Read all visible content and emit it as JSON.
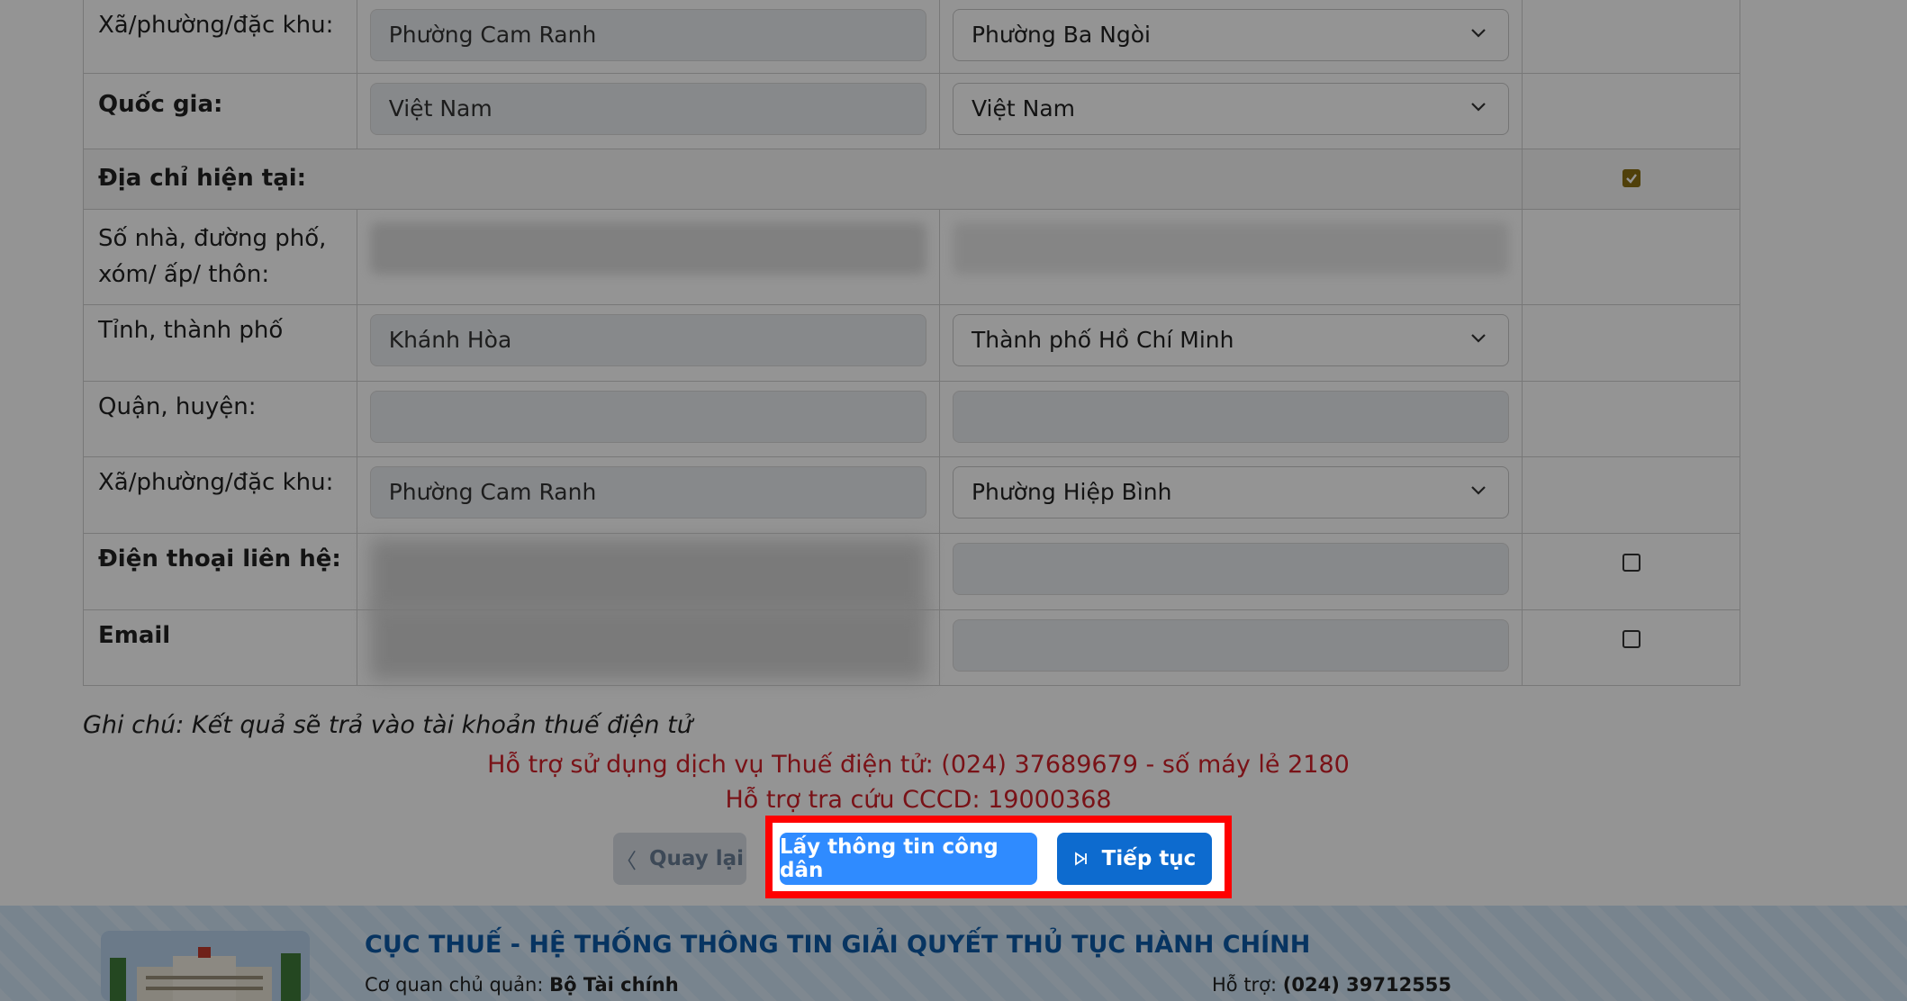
{
  "rows": [
    {
      "label": "Xã/phường/đặc khu:",
      "bold": false,
      "old_value": "Phường Cam Ranh",
      "new_value": "Phường Ba Ngòi",
      "new_type": "select"
    },
    {
      "label": "Quốc gia:",
      "bold": true,
      "old_value": "Việt Nam",
      "new_value": "Việt Nam",
      "new_type": "select"
    },
    {
      "label": "Địa chỉ hiện tại:",
      "bold": true
    },
    {
      "label": "Số nhà, đường phố, xóm/ ấp/ thôn:",
      "bold": false
    },
    {
      "label": "Tỉnh, thành phố",
      "bold": false,
      "old_value": "Khánh Hòa",
      "new_value": "Thành phố Hồ Chí Minh",
      "new_type": "select"
    },
    {
      "label": "Quận, huyện:",
      "bold": false,
      "old_value": "",
      "new_value": ""
    },
    {
      "label": "Xã/phường/đặc khu:",
      "bold": false,
      "old_value": "Phường Cam Ranh",
      "new_value": "Phường Hiệp Bình",
      "new_type": "select"
    },
    {
      "label": "Điện thoại liên hệ:",
      "bold": true
    },
    {
      "label": "Email",
      "bold": true
    }
  ],
  "checkboxes": {
    "current_address": true,
    "phone": false,
    "email": false
  },
  "note": "Ghi chú: Kết quả sẽ trả vào tài khoản thuế điện tử",
  "support_line_1": "Hỗ trợ sử dụng dịch vụ Thuế điện tử: (024) 37689679 - số máy lẻ 2180",
  "support_line_2": "Hỗ trợ tra cứu CCCD: 19000368",
  "buttons": {
    "back": "Quay lại",
    "fetch": "Lấy thông tin công dân",
    "next": "Tiếp tục"
  },
  "footer": {
    "title": "CỤC THUẾ - HỆ THỐNG THÔNG TIN GIẢI QUYẾT THỦ TỤC HÀNH CHÍNH",
    "owner_label": "Cơ quan chủ quản:",
    "owner_value": "Bộ Tài chính",
    "support_label": "Hỗ trợ:",
    "support_value": "(024) 39712555"
  },
  "colors": {
    "highlight": "#ff0000",
    "primary": "#0d6bcf",
    "support_text": "#d01f28"
  }
}
